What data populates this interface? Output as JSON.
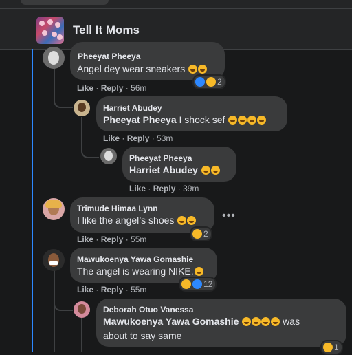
{
  "group": {
    "name": "Tell It Moms"
  },
  "actions": {
    "like": "Like",
    "reply": "Reply",
    "sep": "·"
  },
  "comments": [
    {
      "name": "Pheeyat Pheeya",
      "text": "Angel dey wear sneakers",
      "time": "56m",
      "reaction_count": "2"
    },
    {
      "name": "Harriet Abudey",
      "mention": "Pheeyat Pheeya",
      "text": "I shock sef",
      "time": "53m"
    },
    {
      "name": "Pheeyat Pheeya",
      "mention": "Harriet Abudey",
      "text": "",
      "time": "39m"
    },
    {
      "name": "Trimude Himaa Lynn",
      "text": "I like the angel’s shoes",
      "time": "55m",
      "reaction_count": "2"
    },
    {
      "name": "Mawukoenya Yawa Gomashie",
      "text": "The angel is wearing NIKE.",
      "time": "55m",
      "reaction_count": "12"
    },
    {
      "name": "Deborah Otuo Vanessa",
      "mention": "Mawukoenya Yawa Gomashie",
      "text": "was",
      "text2": "about to say same",
      "reaction_count": "1"
    }
  ],
  "more_options": "•••",
  "colors": {
    "bg": "#18191a",
    "bubble": "#3a3b3c",
    "thread": "#2d88ff",
    "muted": "#b0b3b8"
  }
}
